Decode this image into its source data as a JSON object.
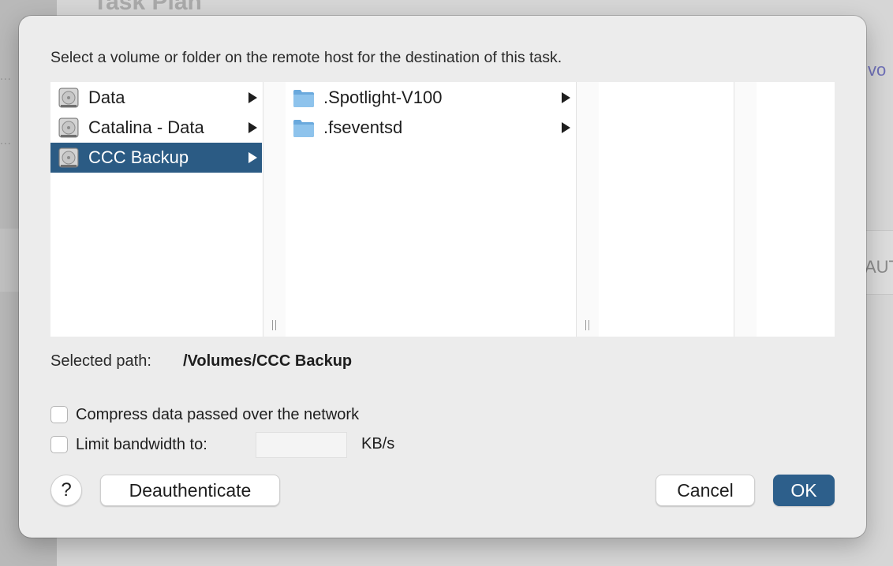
{
  "background": {
    "title": "Task Plan",
    "right_text_top": "vo",
    "right_text_mid": "AUT",
    "dots": "..."
  },
  "dialog": {
    "prompt": "Select a volume or folder on the remote host for the destination of this task.",
    "columns": [
      {
        "items": [
          {
            "label": "Data",
            "icon": "hard-drive-icon",
            "has_children": true,
            "selected": false
          },
          {
            "label": "Catalina - Data",
            "icon": "hard-drive-icon",
            "has_children": true,
            "selected": false
          },
          {
            "label": "CCC Backup",
            "icon": "hard-drive-icon",
            "has_children": true,
            "selected": true
          }
        ]
      },
      {
        "items": [
          {
            "label": ".Spotlight-V100",
            "icon": "folder-icon",
            "has_children": true,
            "selected": false
          },
          {
            "label": ".fseventsd",
            "icon": "folder-icon",
            "has_children": true,
            "selected": false
          }
        ]
      }
    ],
    "selected_path_label": "Selected path:",
    "selected_path_value": "/Volumes/CCC Backup",
    "compress_label": "Compress data passed over the network",
    "compress_checked": false,
    "limit_label": "Limit bandwidth to:",
    "limit_checked": false,
    "limit_value": "",
    "limit_unit": "KB/s",
    "help_label": "?",
    "deauth_label": "Deauthenticate",
    "cancel_label": "Cancel",
    "ok_label": "OK",
    "accent_color": "#2b5b84"
  }
}
